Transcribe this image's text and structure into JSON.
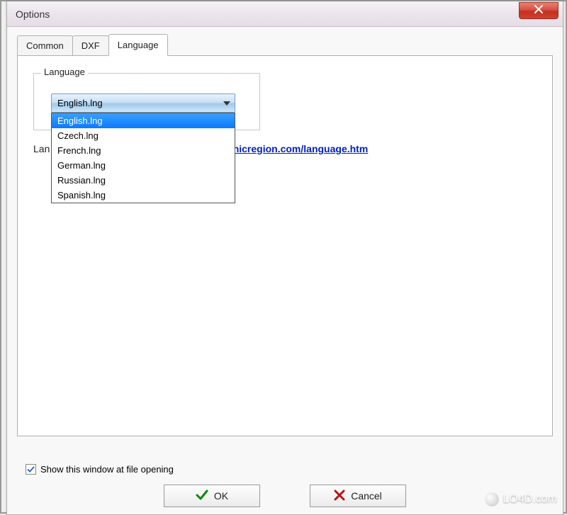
{
  "window": {
    "title": "Options"
  },
  "tabs": [
    {
      "label": "Common",
      "active": false
    },
    {
      "label": "DXF",
      "active": false
    },
    {
      "label": "Language",
      "active": true
    }
  ],
  "group": {
    "legend": "Language"
  },
  "combo": {
    "selected": "English.lng",
    "options": [
      "English.lng",
      "Czech.lng",
      "French.lng",
      "German.lng",
      "Russian.lng",
      "Spanish.lng"
    ]
  },
  "link": {
    "prefix_visible": "Lan",
    "url_visible": "aphicregion.com/language.htm"
  },
  "checkbox": {
    "label": "Show this window at file opening",
    "checked": true
  },
  "buttons": {
    "ok": "OK",
    "cancel": "Cancel"
  },
  "watermark": {
    "text": "LO4D.com"
  }
}
